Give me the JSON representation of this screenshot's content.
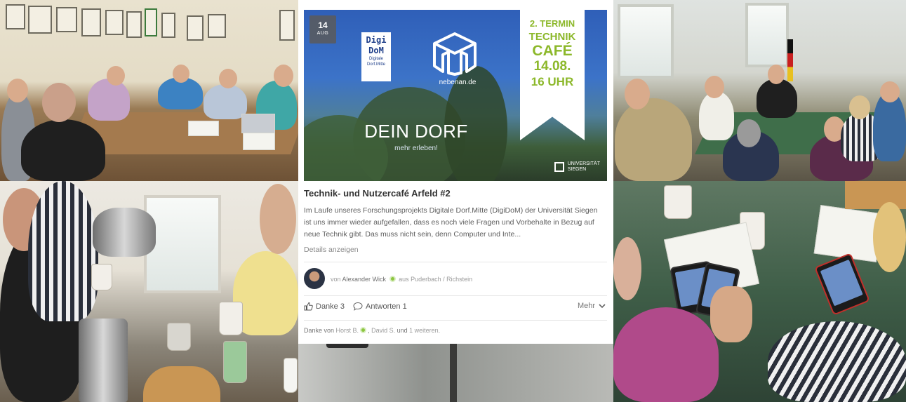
{
  "banner": {
    "date_day": "14",
    "date_month": "AUG",
    "digidom_line1": "Digi",
    "digidom_line2": "DoM",
    "digidom_line3": "Digitale",
    "digidom_line4": "Dorf.Mitte",
    "brand": "nebenan.de",
    "headline": "DEIN DORF",
    "tagline": "mehr erleben!",
    "flag_termin": "2. TERMIN",
    "flag_technik": "TECHNIK",
    "flag_cafe": "CAFÉ",
    "flag_date": "14.08.",
    "flag_time": "16 UHR",
    "uni_line1": "UNIVERSITÄT",
    "uni_line2": "SIEGEN",
    "accent": "#8cb82a"
  },
  "post": {
    "title": "Technik- und Nutzercafé Arfeld #2",
    "body": "Im Laufe unseres Forschungsprojekts Digitale Dorf.Mitte (DigiDoM) der Universität Siegen ist uns immer wieder aufgefallen, dass es noch viele Fragen und Vorbehalte in Bezug auf neue Technik gibt. Das muss nicht sein, denn Computer und Inte...",
    "details_label": "Details anzeigen",
    "author_prefix": "von",
    "author_name": "Alexander Wick",
    "author_location": "aus Puderbach / Richstein",
    "thanks_label": "Danke 3",
    "replies_label": "Antworten 1",
    "more_label": "Mehr",
    "thanks_prefix": "Danke von",
    "thanks_user1": "Horst B.",
    "thanks_user2": "David S.",
    "thanks_and": "und",
    "thanks_more": "1 weiteren."
  }
}
